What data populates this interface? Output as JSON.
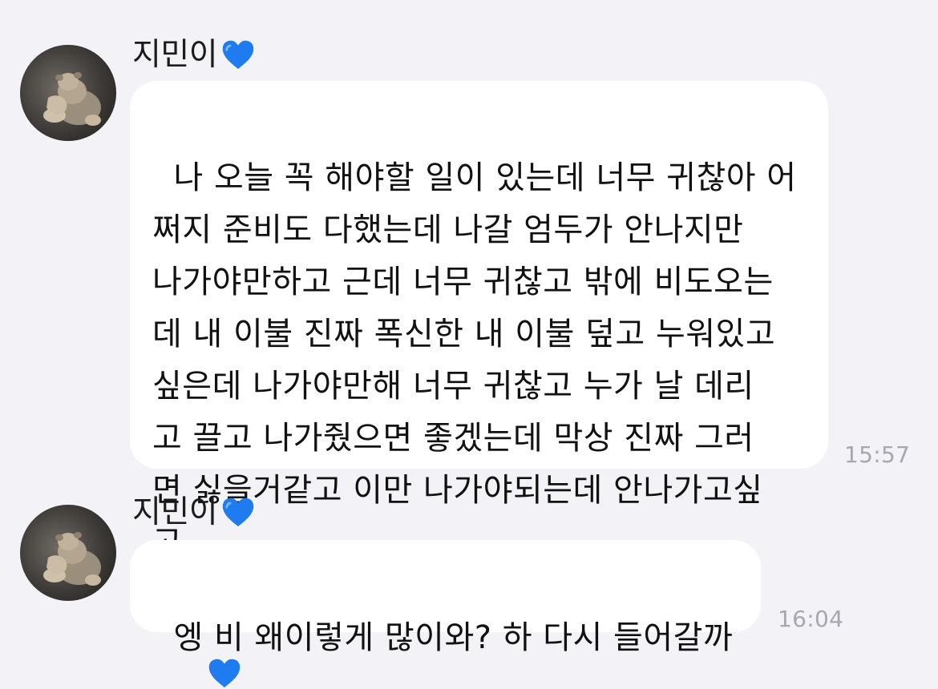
{
  "messages": [
    {
      "sender": "지민이",
      "avatar_icon": "bear-figurine-avatar-icon",
      "name_badge_icon": "blue-heart-icon",
      "text": "나 오늘 꼭 해야할 일이 있는데 너무 귀찮아 어\n쩌지 준비도 다했는데 나갈 엄두가 안나지만\n나가야만하고 근데 너무 귀찮고 밖에 비도오는\n데 내 이불 진짜 폭신한 내 이불 덮고 누워있고\n싶은데 나가야만해 너무 귀찮고 누가 날 데리\n고 끌고 나가줬으면 좋겠는데 막상 진짜 그러\n면 싫을거같고 이만 나가야되는데 안나가고싶\n고",
      "time": "15:57"
    },
    {
      "sender": "지민이",
      "avatar_icon": "bear-figurine-avatar-icon",
      "name_badge_icon": "blue-heart-icon",
      "text": "엥 비 왜이렇게 많이와? 하 다시 들어갈까",
      "time": "16:04"
    }
  ],
  "colors": {
    "background": "#f2f2f7",
    "bubble": "#ffffff",
    "timestamp": "#a7a7ad",
    "heart": "#1f7cf0"
  }
}
